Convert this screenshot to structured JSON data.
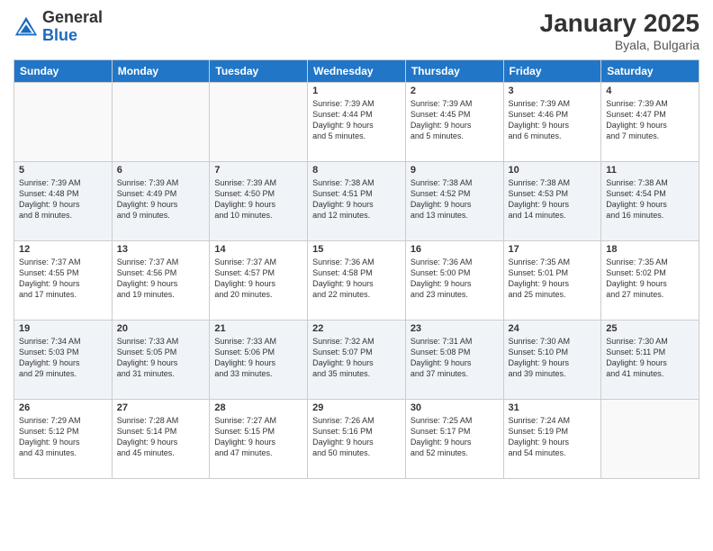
{
  "header": {
    "logo_general": "General",
    "logo_blue": "Blue",
    "month_year": "January 2025",
    "location": "Byala, Bulgaria"
  },
  "weekdays": [
    "Sunday",
    "Monday",
    "Tuesday",
    "Wednesday",
    "Thursday",
    "Friday",
    "Saturday"
  ],
  "weeks": [
    [
      {
        "day": "",
        "info": ""
      },
      {
        "day": "",
        "info": ""
      },
      {
        "day": "",
        "info": ""
      },
      {
        "day": "1",
        "info": "Sunrise: 7:39 AM\nSunset: 4:44 PM\nDaylight: 9 hours\nand 5 minutes."
      },
      {
        "day": "2",
        "info": "Sunrise: 7:39 AM\nSunset: 4:45 PM\nDaylight: 9 hours\nand 5 minutes."
      },
      {
        "day": "3",
        "info": "Sunrise: 7:39 AM\nSunset: 4:46 PM\nDaylight: 9 hours\nand 6 minutes."
      },
      {
        "day": "4",
        "info": "Sunrise: 7:39 AM\nSunset: 4:47 PM\nDaylight: 9 hours\nand 7 minutes."
      }
    ],
    [
      {
        "day": "5",
        "info": "Sunrise: 7:39 AM\nSunset: 4:48 PM\nDaylight: 9 hours\nand 8 minutes."
      },
      {
        "day": "6",
        "info": "Sunrise: 7:39 AM\nSunset: 4:49 PM\nDaylight: 9 hours\nand 9 minutes."
      },
      {
        "day": "7",
        "info": "Sunrise: 7:39 AM\nSunset: 4:50 PM\nDaylight: 9 hours\nand 10 minutes."
      },
      {
        "day": "8",
        "info": "Sunrise: 7:38 AM\nSunset: 4:51 PM\nDaylight: 9 hours\nand 12 minutes."
      },
      {
        "day": "9",
        "info": "Sunrise: 7:38 AM\nSunset: 4:52 PM\nDaylight: 9 hours\nand 13 minutes."
      },
      {
        "day": "10",
        "info": "Sunrise: 7:38 AM\nSunset: 4:53 PM\nDaylight: 9 hours\nand 14 minutes."
      },
      {
        "day": "11",
        "info": "Sunrise: 7:38 AM\nSunset: 4:54 PM\nDaylight: 9 hours\nand 16 minutes."
      }
    ],
    [
      {
        "day": "12",
        "info": "Sunrise: 7:37 AM\nSunset: 4:55 PM\nDaylight: 9 hours\nand 17 minutes."
      },
      {
        "day": "13",
        "info": "Sunrise: 7:37 AM\nSunset: 4:56 PM\nDaylight: 9 hours\nand 19 minutes."
      },
      {
        "day": "14",
        "info": "Sunrise: 7:37 AM\nSunset: 4:57 PM\nDaylight: 9 hours\nand 20 minutes."
      },
      {
        "day": "15",
        "info": "Sunrise: 7:36 AM\nSunset: 4:58 PM\nDaylight: 9 hours\nand 22 minutes."
      },
      {
        "day": "16",
        "info": "Sunrise: 7:36 AM\nSunset: 5:00 PM\nDaylight: 9 hours\nand 23 minutes."
      },
      {
        "day": "17",
        "info": "Sunrise: 7:35 AM\nSunset: 5:01 PM\nDaylight: 9 hours\nand 25 minutes."
      },
      {
        "day": "18",
        "info": "Sunrise: 7:35 AM\nSunset: 5:02 PM\nDaylight: 9 hours\nand 27 minutes."
      }
    ],
    [
      {
        "day": "19",
        "info": "Sunrise: 7:34 AM\nSunset: 5:03 PM\nDaylight: 9 hours\nand 29 minutes."
      },
      {
        "day": "20",
        "info": "Sunrise: 7:33 AM\nSunset: 5:05 PM\nDaylight: 9 hours\nand 31 minutes."
      },
      {
        "day": "21",
        "info": "Sunrise: 7:33 AM\nSunset: 5:06 PM\nDaylight: 9 hours\nand 33 minutes."
      },
      {
        "day": "22",
        "info": "Sunrise: 7:32 AM\nSunset: 5:07 PM\nDaylight: 9 hours\nand 35 minutes."
      },
      {
        "day": "23",
        "info": "Sunrise: 7:31 AM\nSunset: 5:08 PM\nDaylight: 9 hours\nand 37 minutes."
      },
      {
        "day": "24",
        "info": "Sunrise: 7:30 AM\nSunset: 5:10 PM\nDaylight: 9 hours\nand 39 minutes."
      },
      {
        "day": "25",
        "info": "Sunrise: 7:30 AM\nSunset: 5:11 PM\nDaylight: 9 hours\nand 41 minutes."
      }
    ],
    [
      {
        "day": "26",
        "info": "Sunrise: 7:29 AM\nSunset: 5:12 PM\nDaylight: 9 hours\nand 43 minutes."
      },
      {
        "day": "27",
        "info": "Sunrise: 7:28 AM\nSunset: 5:14 PM\nDaylight: 9 hours\nand 45 minutes."
      },
      {
        "day": "28",
        "info": "Sunrise: 7:27 AM\nSunset: 5:15 PM\nDaylight: 9 hours\nand 47 minutes."
      },
      {
        "day": "29",
        "info": "Sunrise: 7:26 AM\nSunset: 5:16 PM\nDaylight: 9 hours\nand 50 minutes."
      },
      {
        "day": "30",
        "info": "Sunrise: 7:25 AM\nSunset: 5:17 PM\nDaylight: 9 hours\nand 52 minutes."
      },
      {
        "day": "31",
        "info": "Sunrise: 7:24 AM\nSunset: 5:19 PM\nDaylight: 9 hours\nand 54 minutes."
      },
      {
        "day": "",
        "info": ""
      }
    ]
  ]
}
